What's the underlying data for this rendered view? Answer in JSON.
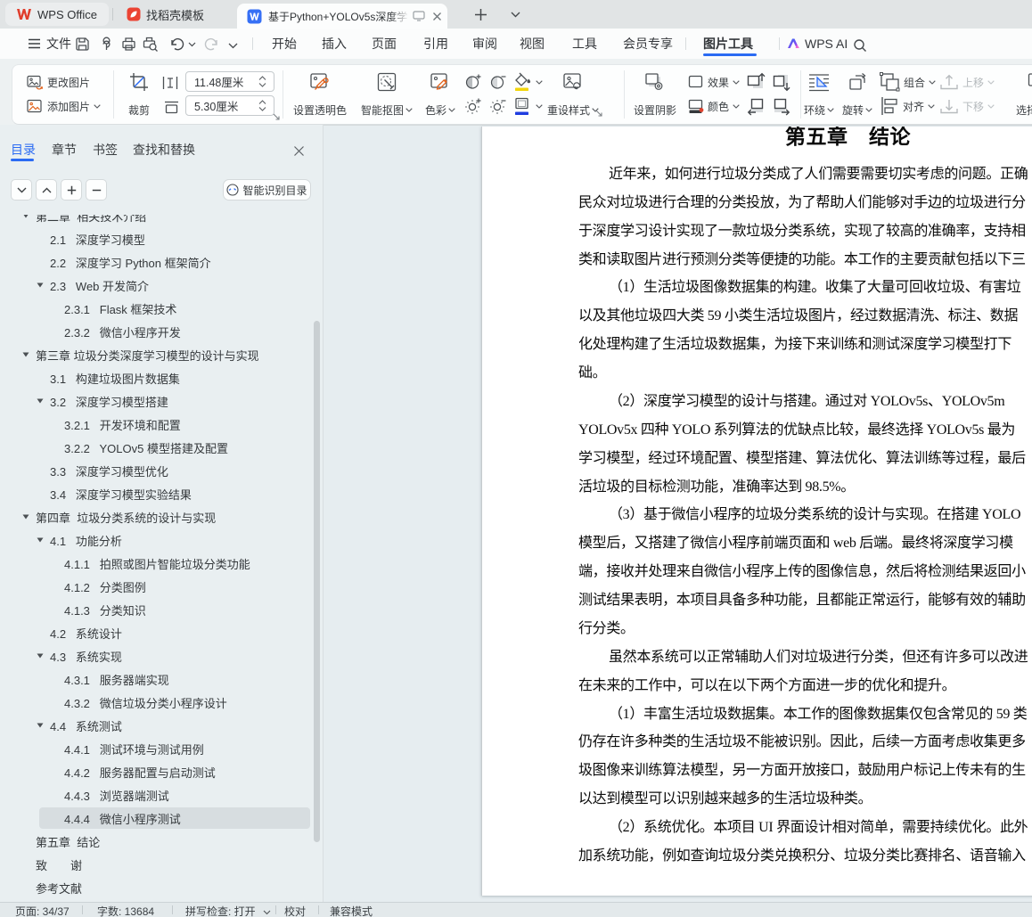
{
  "window": {
    "tabs": {
      "home": "WPS Office",
      "docer": "找稻壳模板",
      "document": "基于Python+YOLOv5s深度学"
    }
  },
  "menubar": {
    "file_label": "文件",
    "tabs": [
      "开始",
      "插入",
      "页面",
      "引用",
      "审阅",
      "视图",
      "工具",
      "会员专享"
    ],
    "active_context_tab": "图片工具",
    "ai_label": "WPS AI"
  },
  "ribbon": {
    "change_picture": "更改图片",
    "add_picture": "添加图片",
    "crop": "裁剪",
    "height_value": "11.48厘米",
    "width_value": "5.30厘米",
    "set_transparent_color": "设置透明色",
    "smart_cutout": "智能抠图",
    "color": "色彩",
    "reset_style": "重设样式",
    "set_shadow": "设置阴影",
    "effects": "效果",
    "picture_color": "颜色",
    "wrap": "环绕",
    "rotate": "旋转",
    "group": "组合",
    "align": "对齐",
    "move_up": "上移",
    "move_down": "下移",
    "selection_pane": "选择窗格"
  },
  "sidebar": {
    "tabs": [
      "目录",
      "章节",
      "书签",
      "查找和替换"
    ],
    "active_tab": "目录",
    "smart_identify": "智能识别目录",
    "toc": [
      {
        "label": "第二章  相关技术介绍",
        "level": 0,
        "arrow": true,
        "selected": false
      },
      {
        "label": "2.1   深度学习模型",
        "level": 1,
        "arrow": false,
        "selected": false
      },
      {
        "label": "2.2   深度学习 Python 框架简介",
        "level": 1,
        "arrow": false,
        "selected": false
      },
      {
        "label": "2.3   Web 开发简介",
        "level": 1,
        "arrow": true,
        "selected": false
      },
      {
        "label": "2.3.1   Flask 框架技术",
        "level": 2,
        "arrow": false,
        "selected": false
      },
      {
        "label": "2.3.2   微信小程序开发",
        "level": 2,
        "arrow": false,
        "selected": false
      },
      {
        "label": "第三章 垃圾分类深度学习模型的设计与实现",
        "level": 0,
        "arrow": true,
        "selected": false
      },
      {
        "label": "3.1   构建垃圾图片数据集",
        "level": 1,
        "arrow": false,
        "selected": false
      },
      {
        "label": "3.2   深度学习模型搭建",
        "level": 1,
        "arrow": true,
        "selected": false
      },
      {
        "label": "3.2.1   开发环境和配置",
        "level": 2,
        "arrow": false,
        "selected": false
      },
      {
        "label": "3.2.2   YOLOv5 模型搭建及配置",
        "level": 2,
        "arrow": false,
        "selected": false
      },
      {
        "label": "3.3   深度学习模型优化",
        "level": 1,
        "arrow": false,
        "selected": false
      },
      {
        "label": "3.4   深度学习模型实验结果",
        "level": 1,
        "arrow": false,
        "selected": false
      },
      {
        "label": "第四章  垃圾分类系统的设计与实现",
        "level": 0,
        "arrow": true,
        "selected": false
      },
      {
        "label": "4.1   功能分析",
        "level": 1,
        "arrow": true,
        "selected": false
      },
      {
        "label": "4.1.1   拍照或图片智能垃圾分类功能",
        "level": 2,
        "arrow": false,
        "selected": false
      },
      {
        "label": "4.1.2   分类图例",
        "level": 2,
        "arrow": false,
        "selected": false
      },
      {
        "label": "4.1.3   分类知识",
        "level": 2,
        "arrow": false,
        "selected": false
      },
      {
        "label": "4.2   系统设计",
        "level": 1,
        "arrow": false,
        "selected": false
      },
      {
        "label": "4.3   系统实现",
        "level": 1,
        "arrow": true,
        "selected": false
      },
      {
        "label": "4.3.1   服务器端实现",
        "level": 2,
        "arrow": false,
        "selected": false
      },
      {
        "label": "4.3.2   微信垃圾分类小程序设计",
        "level": 2,
        "arrow": false,
        "selected": false
      },
      {
        "label": "4.4   系统测试",
        "level": 1,
        "arrow": true,
        "selected": false
      },
      {
        "label": "4.4.1   测试环境与测试用例",
        "level": 2,
        "arrow": false,
        "selected": false
      },
      {
        "label": "4.4.2   服务器配置与启动测试",
        "level": 2,
        "arrow": false,
        "selected": false
      },
      {
        "label": "4.4.3   浏览器端测试",
        "level": 2,
        "arrow": false,
        "selected": false
      },
      {
        "label": "4.4.4   微信小程序测试",
        "level": 2,
        "arrow": false,
        "selected": true
      },
      {
        "label": "第五章  结论",
        "level": 0,
        "arrow": false,
        "selected": false
      },
      {
        "label": "致　　谢",
        "level": 0,
        "arrow": false,
        "selected": false
      },
      {
        "label": "参考文献",
        "level": 0,
        "arrow": false,
        "selected": false
      }
    ]
  },
  "document": {
    "heading": "第五章　结论",
    "lines": [
      {
        "text": "近年来，如何进行垃圾分类成了人们需要需要切实考虑的问题。正确",
        "indent": true
      },
      {
        "text": "民众对垃圾进行合理的分类投放，为了帮助人们能够对手边的垃圾进行分",
        "indent": false
      },
      {
        "text": "于深度学习设计实现了一款垃圾分类系统，实现了较高的准确率，支持相",
        "indent": false
      },
      {
        "text": "类和读取图片进行预测分类等便捷的功能。本工作的主要贡献包括以下三",
        "indent": false
      },
      {
        "text": "（1）生活垃圾图像数据集的构建。收集了大量可回收垃圾、有害垃",
        "indent": true
      },
      {
        "text": "以及其他垃圾四大类 59 小类生活垃圾图片，经过数据清洗、标注、数据",
        "indent": false
      },
      {
        "text": "化处理构建了生活垃圾数据集，为接下来训练和测试深度学习模型打下",
        "indent": false
      },
      {
        "text": "础。",
        "indent": false
      },
      {
        "text": "（2）深度学习模型的设计与搭建。通过对 YOLOv5s、YOLOv5m",
        "indent": true
      },
      {
        "text": "YOLOv5x 四种 YOLO 系列算法的优缺点比较，最终选择 YOLOv5s 最为",
        "indent": false
      },
      {
        "text": "学习模型，经过环境配置、模型搭建、算法优化、算法训练等过程，最后",
        "indent": false
      },
      {
        "text": "活垃圾的目标检测功能，准确率达到 98.5%。",
        "indent": false
      },
      {
        "text": "（3）基于微信小程序的垃圾分类系统的设计与实现。在搭建 YOLO",
        "indent": true
      },
      {
        "text": "模型后，又搭建了微信小程序前端页面和 web 后端。最终将深度学习模",
        "indent": false
      },
      {
        "text": "端，接收并处理来自微信小程序上传的图像信息，然后将检测结果返回小",
        "indent": false
      },
      {
        "text": "测试结果表明，本项目具备多种功能，且都能正常运行，能够有效的辅助",
        "indent": false
      },
      {
        "text": "行分类。",
        "indent": false
      },
      {
        "text": "虽然本系统可以正常辅助人们对垃圾进行分类，但还有许多可以改进",
        "indent": true
      },
      {
        "text": "在未来的工作中，可以在以下两个方面进一步的优化和提升。",
        "indent": false
      },
      {
        "text": "（1）丰富生活垃圾数据集。本工作的图像数据集仅包含常见的 59 类",
        "indent": true
      },
      {
        "text": "仍存在许多种类的生活垃圾不能被识别。因此，后续一方面考虑收集更多",
        "indent": false
      },
      {
        "text": "圾图像来训练算法模型，另一方面开放接口，鼓励用户标记上传未有的生",
        "indent": false
      },
      {
        "text": "以达到模型可以识别越来越多的生活垃圾种类。",
        "indent": false
      },
      {
        "text": "（2）系统优化。本项目 UI 界面设计相对简单，需要持续优化。此外",
        "indent": true
      },
      {
        "text": "加系统功能，例如查询垃圾分类兑换积分、垃圾分类比赛排名、语音输入",
        "indent": false
      }
    ]
  },
  "statusbar": {
    "page": "页面: 34/37",
    "words": "字数: 13684",
    "spellcheck": "拼写检查: 打开",
    "proofread": "校对",
    "compat_mode": "兼容模式"
  },
  "colors": {
    "accent_blue": "#2b6bf3",
    "accent_orange": "#e2621b",
    "fill_yellow": "#f2d50c",
    "border_blue": "#1f3de0",
    "wps_red": "#e03e2d"
  }
}
